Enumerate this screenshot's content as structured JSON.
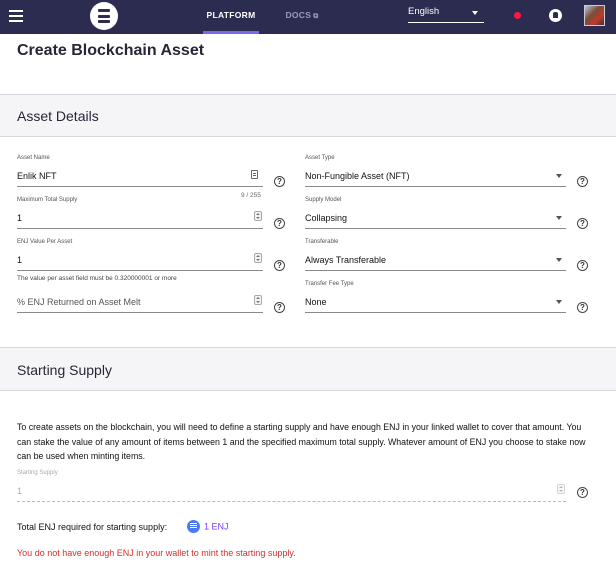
{
  "nav": {
    "platform": "PLATFORM",
    "docs": "DOCS",
    "docs_icon": "external-link-icon",
    "language": "English",
    "accent_color": "#7b68ee",
    "bar_color": "#2c2c51"
  },
  "page": {
    "title": "Create Blockchain Asset"
  },
  "asset_details": {
    "title": "Asset Details",
    "name": {
      "label": "Asset Name",
      "value": "Enlik NFT",
      "counter": "9 / 255"
    },
    "type": {
      "label": "Asset Type",
      "value": "Non-Fungible Asset (NFT)"
    },
    "max_supply": {
      "label": "Maximum Total Supply",
      "value": "1"
    },
    "supply_model": {
      "label": "Supply Model",
      "value": "Collapsing"
    },
    "enj_value": {
      "label": "ENJ Value Per Asset",
      "value": "1",
      "hint": "The value per asset field must be 0.320000001 or more"
    },
    "transferable": {
      "label": "Transferable",
      "value": "Always Transferable"
    },
    "melt": {
      "placeholder": "% ENJ Returned on Asset Melt"
    },
    "fee_type": {
      "label": "Transfer Fee Type",
      "value": "None"
    },
    "help": "?"
  },
  "starting_supply": {
    "title": "Starting Supply",
    "description": "To create assets on the blockchain, you will need to define a starting supply and have enough ENJ in your linked wallet to cover that amount. You can stake the value of any amount of items between 1 and the specified maximum total supply. Whatever amount of ENJ you choose to stake now can be used when minting items.",
    "field": {
      "label": "Starting Supply",
      "value": "1"
    },
    "total_label": "Total ENJ required for starting supply:",
    "total_value": "1 ENJ",
    "error": "You do not have enough ENJ in your wallet to mint the starting supply.",
    "error_color": "#d32f2f",
    "help": "?"
  }
}
